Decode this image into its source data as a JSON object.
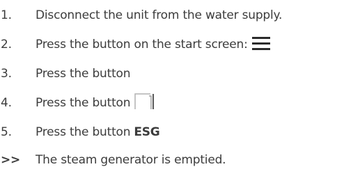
{
  "steps": [
    {
      "number": "1.",
      "text": "Disconnect the unit from the water supply."
    },
    {
      "number": "2.",
      "text": "Press the button on the start screen:",
      "icon": "hamburger-menu-icon"
    },
    {
      "number": "3.",
      "text": "Press the button"
    },
    {
      "number": "4.",
      "text": "Press the button",
      "icon": "corner-bracket-icon"
    },
    {
      "number": "5.",
      "text": "Press the button",
      "bold_text": "ESG"
    }
  ],
  "result": {
    "marker": ">>",
    "text": "The steam generator is emptied."
  },
  "colors": {
    "text": "#3c3c3c",
    "icon": "#2b2b2b",
    "icon_light": "#8a8a8a"
  }
}
